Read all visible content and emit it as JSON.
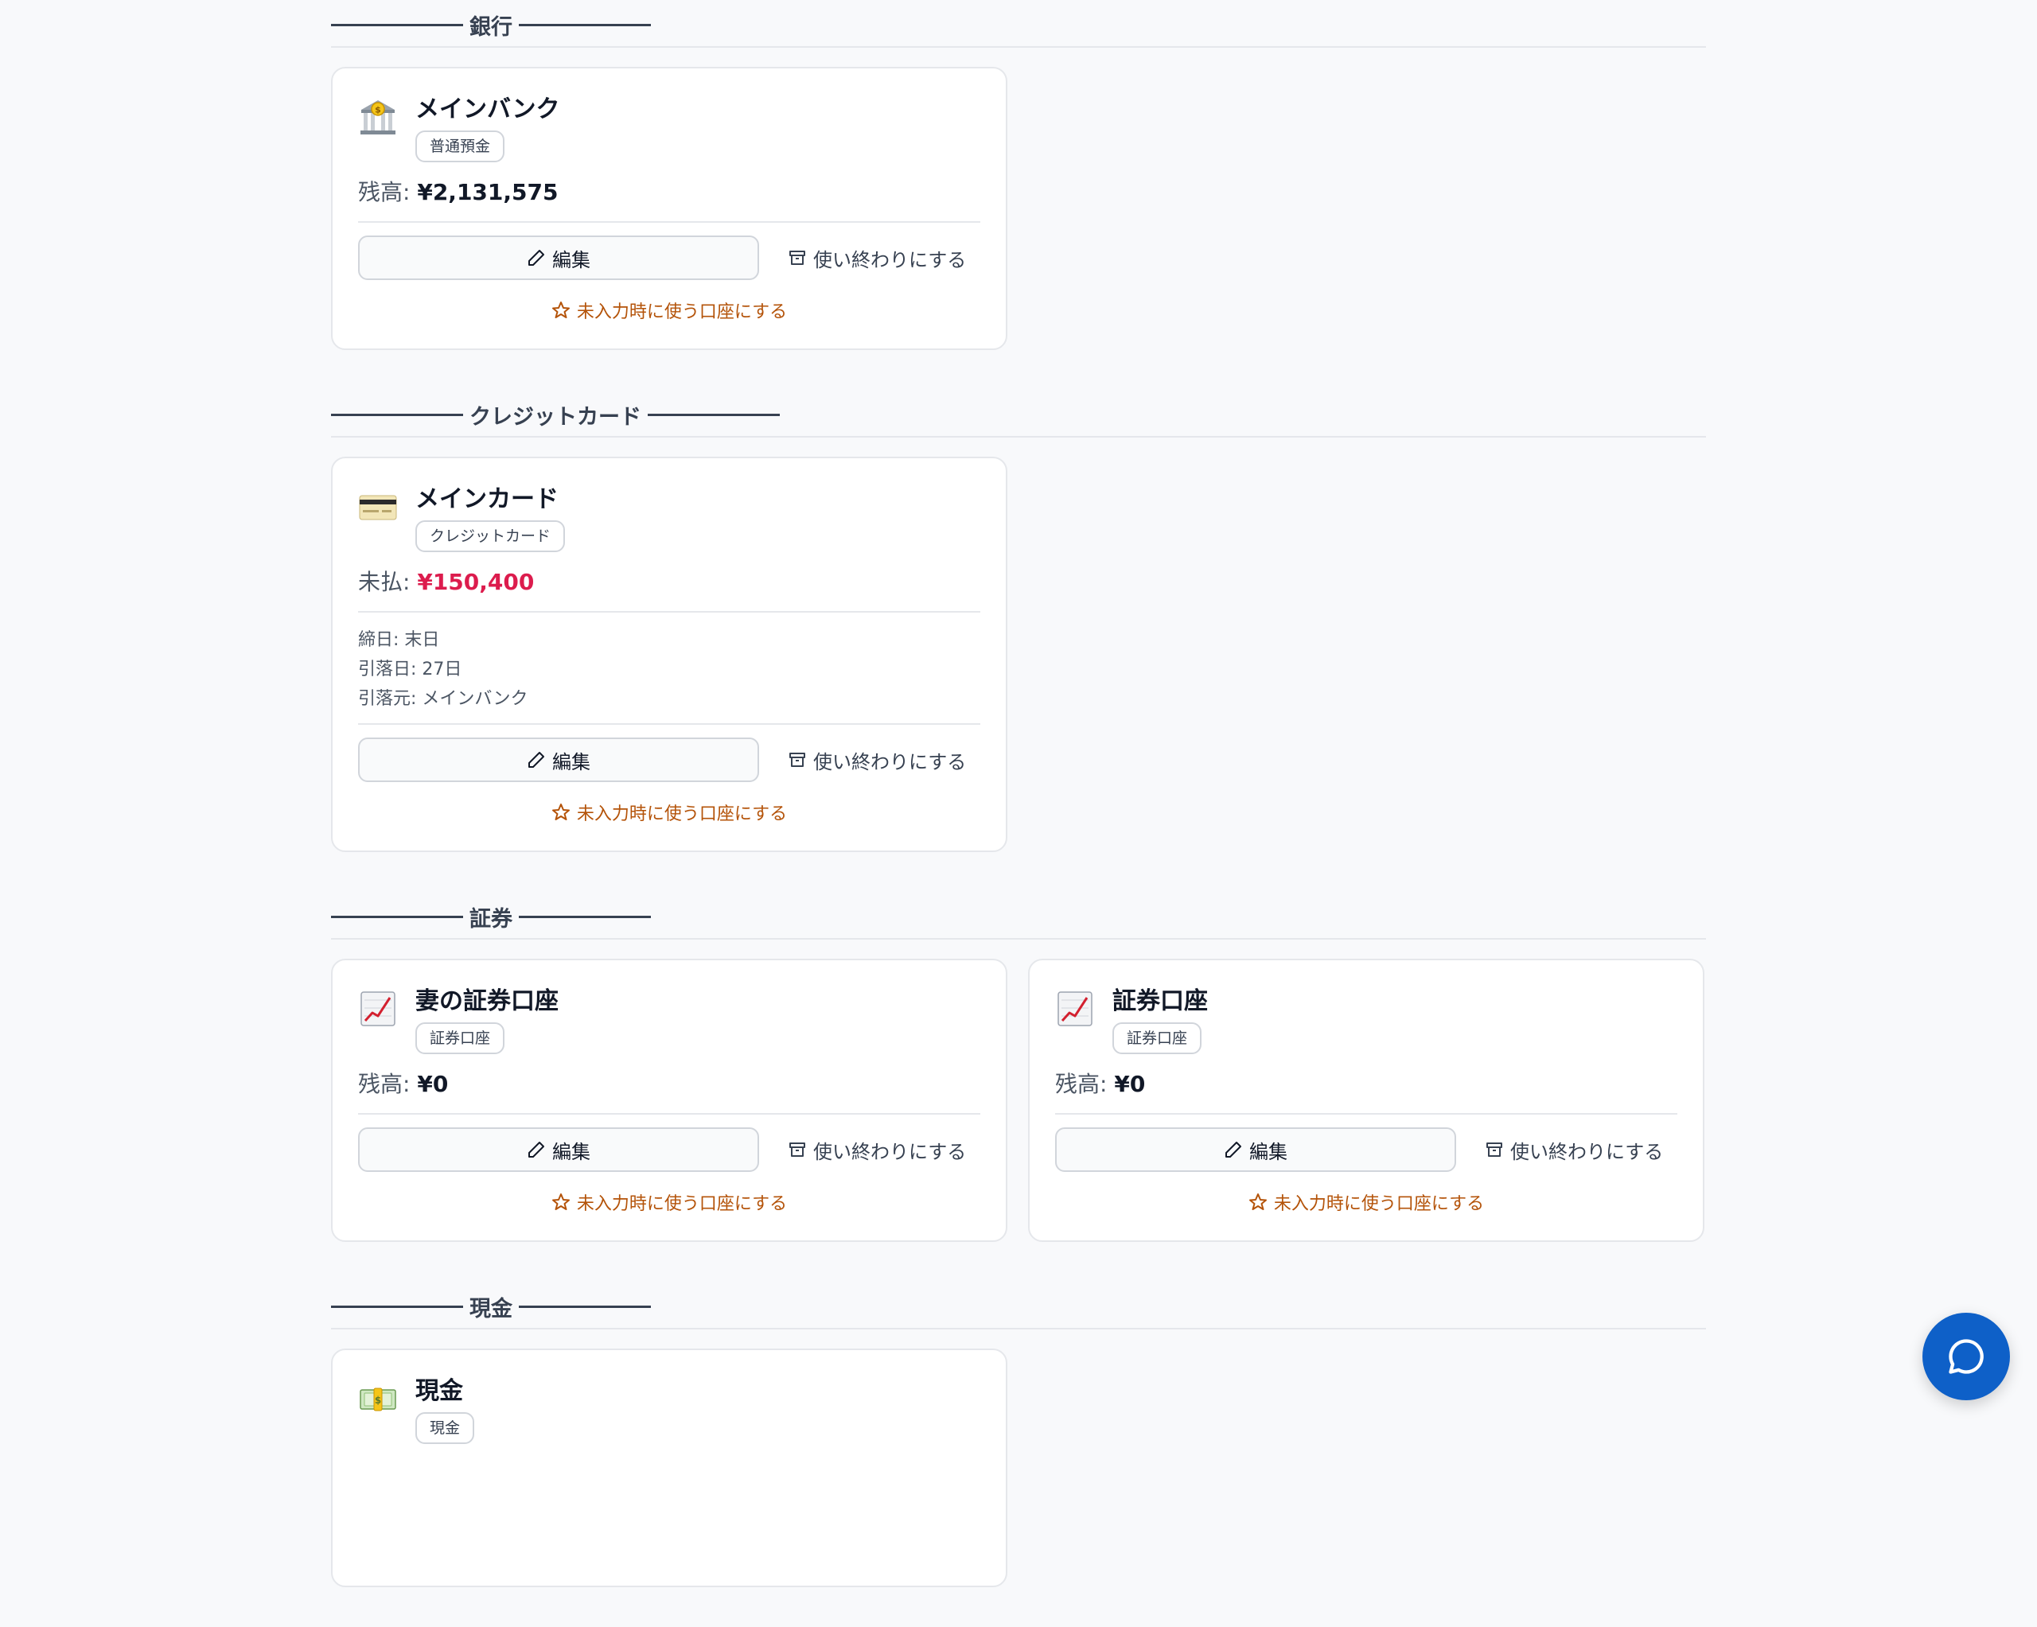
{
  "sections": [
    {
      "title": "銀行",
      "accounts": [
        {
          "name": "メインバンク",
          "icon": "bank-icon",
          "type": "普通預金",
          "amount_label": "残高:",
          "amount": "¥2,131,575",
          "edit_label": "編集",
          "archive_label": "使い終わりにする",
          "default_label": "未入力時に使う口座にする"
        }
      ]
    },
    {
      "title": "クレジットカード",
      "accounts": [
        {
          "name": "メインカード",
          "icon": "credit-card-icon",
          "type": "クレジットカード",
          "amount_label": "未払:",
          "amount": "¥150,400",
          "details": [
            "締日: 末日",
            "引落日: 27日",
            "引落元: メインバンク"
          ],
          "edit_label": "編集",
          "archive_label": "使い終わりにする",
          "default_label": "未入力時に使う口座にする"
        }
      ]
    },
    {
      "title": "証券",
      "accounts": [
        {
          "name": "妻の証券口座",
          "icon": "chart-increasing-icon",
          "type": "証券口座",
          "amount_label": "残高:",
          "amount": "¥0",
          "edit_label": "編集",
          "archive_label": "使い終わりにする",
          "default_label": "未入力時に使う口座にする"
        },
        {
          "name": "証券口座",
          "icon": "chart-increasing-icon",
          "type": "証券口座",
          "amount_label": "残高:",
          "amount": "¥0",
          "edit_label": "編集",
          "archive_label": "使い終わりにする",
          "default_label": "未入力時に使う口座にする"
        }
      ]
    },
    {
      "title": "現金",
      "accounts": [
        {
          "name": "現金",
          "icon": "money-bag-icon",
          "type": "現金"
        }
      ]
    }
  ],
  "colors": {
    "debt": "#dc1c4d",
    "default_link": "#b45309",
    "chat_button": "#0e60c8"
  },
  "chat_icon": "chat-bubble-icon"
}
